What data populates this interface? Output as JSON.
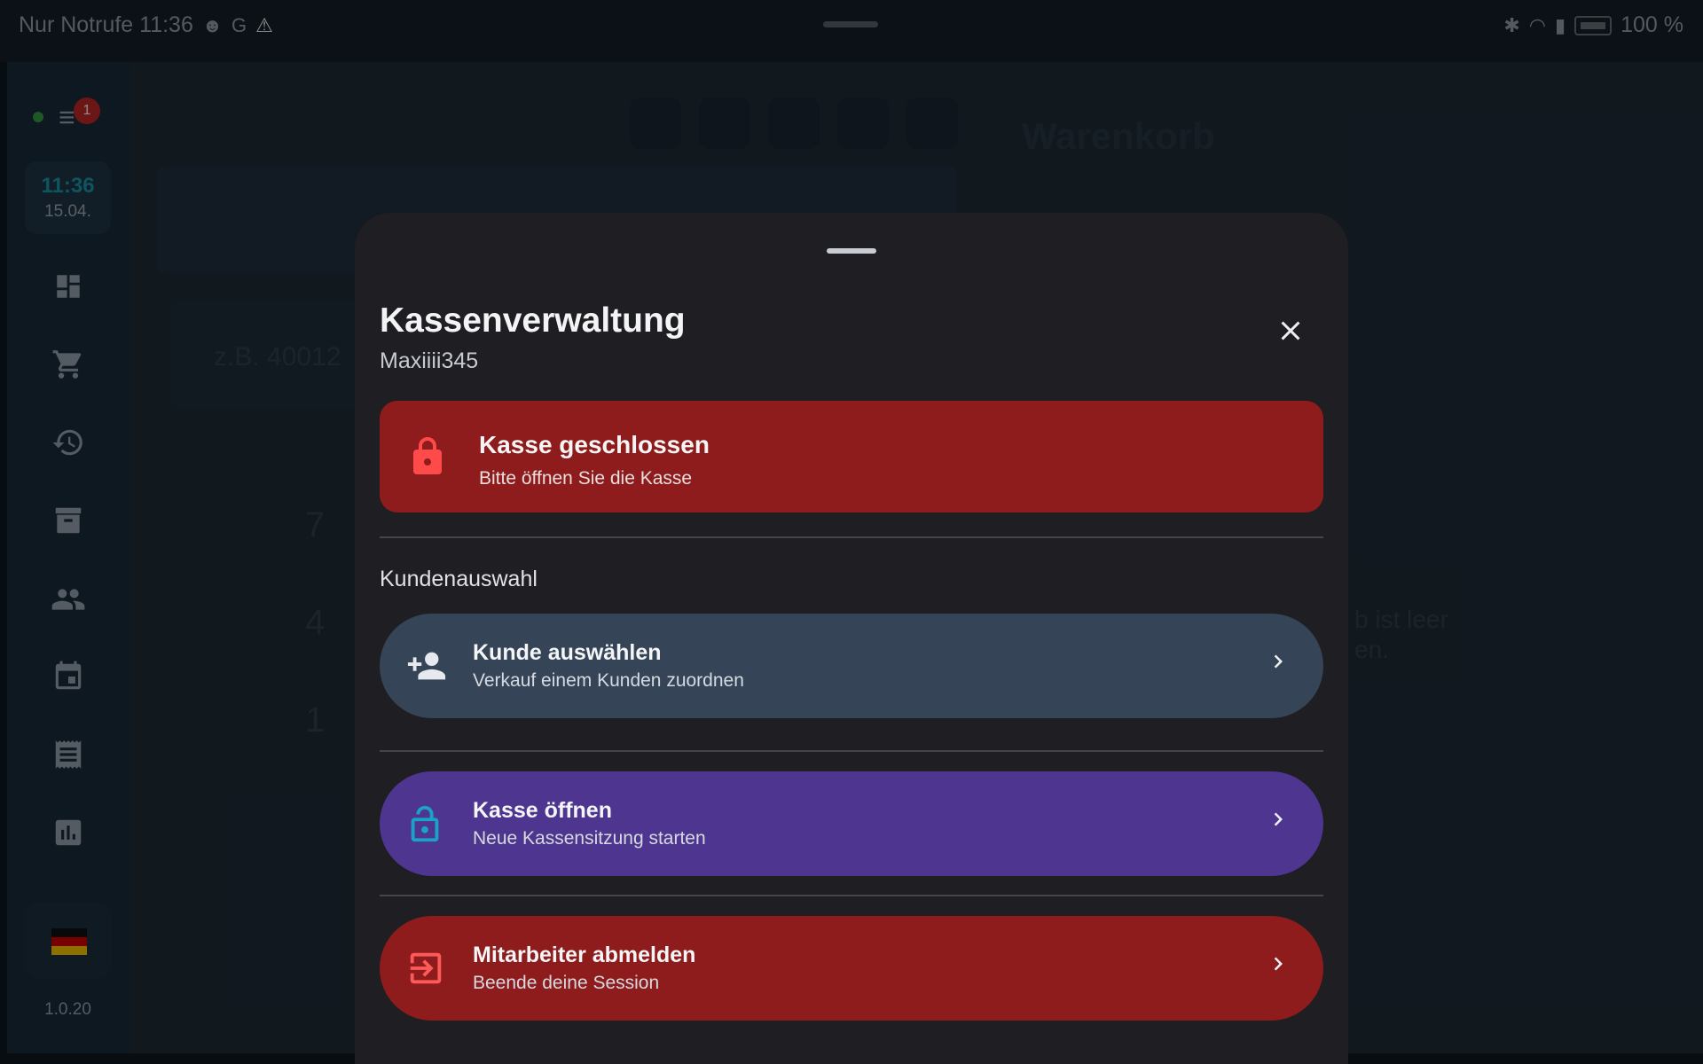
{
  "statusbar": {
    "left_text": "Nur Notrufe 11:36",
    "battery_text": "100 %"
  },
  "sidebar": {
    "badge_count": "1",
    "clock_time": "11:36",
    "clock_date": "15.04.",
    "nav_icons": [
      "dashboard-icon",
      "cart-icon",
      "history-icon",
      "archive-icon",
      "customers-icon",
      "calendar-icon",
      "receipt-icon",
      "reports-icon"
    ],
    "version": "1.0.20"
  },
  "background": {
    "cart_title": "Warenkorb",
    "search_placeholder": "z.B. 40012",
    "keypad_digits": [
      "7",
      "4",
      "1"
    ],
    "empty_line1": "b ist leer",
    "empty_line2": "en."
  },
  "sheet": {
    "title": "Kassenverwaltung",
    "subtitle": "Maxiiii345",
    "status": {
      "heading": "Kasse geschlossen",
      "text": "Bitte öffnen Sie die Kasse",
      "color": "#8e1c1c"
    },
    "section_label": "Kundenauswahl",
    "actions": {
      "customer": {
        "heading": "Kunde auswählen",
        "text": "Verkauf einem Kunden zuordnen",
        "color": "#354557"
      },
      "open": {
        "heading": "Kasse öffnen",
        "text": "Neue Kassensitzung starten",
        "color": "#4e3690"
      },
      "logout": {
        "heading": "Mitarbeiter abmelden",
        "text": "Beende deine Session",
        "color": "#8e1c1c"
      }
    }
  }
}
